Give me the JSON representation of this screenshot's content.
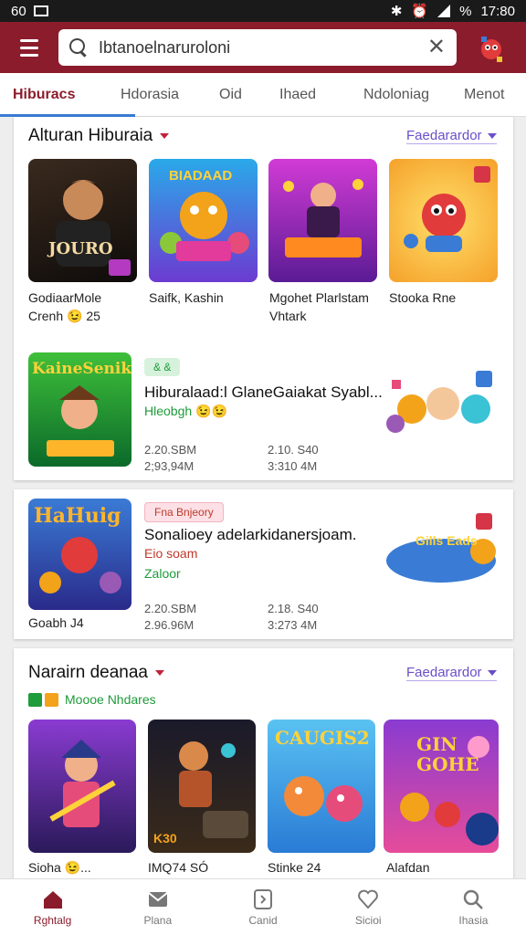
{
  "status_bar": {
    "time": "17:80",
    "left_text": "60",
    "battery": "%"
  },
  "header": {
    "search_value": "Ibtanoelnaruroloni",
    "menu_icon": "hamburger-icon",
    "close_icon": "close-icon"
  },
  "tabs": [
    {
      "label": "Hiburacs"
    },
    {
      "label": "Hdorasia"
    },
    {
      "label": "Oid"
    },
    {
      "label": "Ihaed"
    },
    {
      "label": "Ndoloniag"
    },
    {
      "label": "Menot"
    }
  ],
  "section1": {
    "title": "Alturan Hiburaia",
    "filter": "Faedarardor",
    "items": [
      {
        "label_line1": "GodiaarMole",
        "label_line2": "Crenh 😉 25",
        "art_text": "JOURO"
      },
      {
        "label_line1": "Saifk, Kashin",
        "label_line2": "",
        "art_text": "BIADAAD"
      },
      {
        "label_line1": "Mgohet Plarlstam",
        "label_line2": "Vhtark",
        "art_text": ""
      },
      {
        "label_line1": "Stooka Rne",
        "label_line2": "",
        "art_text": ""
      }
    ]
  },
  "featured1": {
    "badge": "& &",
    "title": "Hiburalaad:l GlaneGaiakat Syabl...",
    "subtitle": "Hleobgh 😉😉",
    "stats": [
      "2.20.SBM",
      "2.10. S40",
      "2;93,94M",
      "3:310 4M"
    ],
    "art_text": "KaineSenik"
  },
  "featured2": {
    "chip": "Fna Bnjeory",
    "title": "Sonalioey adelarkidanersjoam.",
    "line2": "Eio soam",
    "line3": "Zaloor",
    "caption": "Goabh J4",
    "stats": [
      "2.20.SBM",
      "2.18. S40",
      "2.96.96M",
      "3:273 4M"
    ],
    "art_text": "HaHuig",
    "art_text2": "Gills Eads"
  },
  "section2": {
    "title": "Narairn deanaa",
    "filter": "Faedarardor",
    "tags_label": "Moooe Nhdares",
    "items": [
      {
        "label": "Sioha 😉...",
        "art_text": ""
      },
      {
        "label": "IMQ74 SÓ",
        "art_text": "K30"
      },
      {
        "label": "Stinke 24",
        "art_text": "CAUGIS2"
      },
      {
        "label": "Alafdan",
        "art_text": "GIN GOHE"
      }
    ]
  },
  "bottom_nav": [
    {
      "label": "Rghtalg",
      "icon": "home-icon"
    },
    {
      "label": "Plana",
      "icon": "mail-icon"
    },
    {
      "label": "Canid",
      "icon": "card-icon"
    },
    {
      "label": "Sicioi",
      "icon": "heart-icon"
    },
    {
      "label": "Ihasia",
      "icon": "search-icon"
    }
  ],
  "colors": {
    "brand": "#8b1c2c",
    "accent": "#3a7bd5",
    "filter": "#6a4fc7"
  }
}
